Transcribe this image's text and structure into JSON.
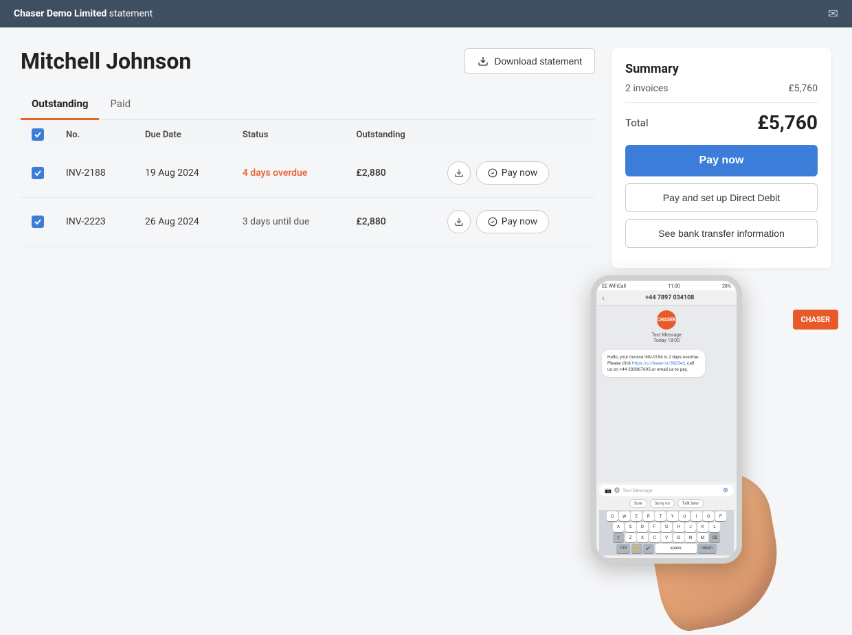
{
  "topbar": {
    "company": "Chaser Demo Limited",
    "suffix": " statement",
    "mail_icon": "✉"
  },
  "page": {
    "title": "Mitchell Johnson",
    "download_btn": "Download statement",
    "tabs": [
      {
        "id": "outstanding",
        "label": "Outstanding",
        "active": true
      },
      {
        "id": "paid",
        "label": "Paid",
        "active": false
      }
    ],
    "table": {
      "headers": [
        "",
        "No.",
        "Due Date",
        "Status",
        "Outstanding",
        ""
      ],
      "rows": [
        {
          "checked": true,
          "number": "INV-2188",
          "due_date": "19 Aug 2024",
          "status": "4 days overdue",
          "status_type": "overdue",
          "outstanding": "£2,880",
          "actions": [
            "download",
            "pay"
          ]
        },
        {
          "checked": true,
          "number": "INV-2223",
          "due_date": "26 Aug 2024",
          "status": "3 days until due",
          "status_type": "due",
          "outstanding": "£2,880",
          "actions": [
            "download",
            "pay"
          ]
        }
      ],
      "pay_label": "Pay now"
    }
  },
  "summary": {
    "title": "Summary",
    "invoice_count": "2 invoices",
    "invoice_total": "£5,760",
    "total_label": "Total",
    "total_amount": "£5,760",
    "btn_pay_now": "Pay now",
    "btn_direct_debit": "Pay and set up Direct Debit",
    "btn_bank_info": "See bank transfer information"
  },
  "phone": {
    "time": "11:00",
    "battery": "28%",
    "signal": "EE WiFiCall",
    "contact_number": "+44 7897 034108",
    "contact_label": "Text Message",
    "contact_date": "Today 18:00",
    "avatar_text": "CHASER",
    "message": "Hello, your invoice INV-0154 is 2 days overdue. Please click https://p.chaser.io/382342, call us on +44 203967695 or email us to pay.",
    "link_text": "https://p.chaser.io/382342",
    "input_placeholder": "Text Message",
    "quick_replies": [
      "Sure",
      "Sorry no",
      "Talk later"
    ],
    "keyboard_rows": [
      [
        "Q",
        "W",
        "E",
        "R",
        "T",
        "Y",
        "U",
        "I",
        "O",
        "P"
      ],
      [
        "A",
        "S",
        "D",
        "F",
        "G",
        "H",
        "J",
        "K",
        "L"
      ],
      [
        "⇧",
        "Z",
        "X",
        "C",
        "V",
        "B",
        "N",
        "M",
        "⌫"
      ],
      [
        "123",
        "🌐",
        "🎤",
        "space",
        "return"
      ]
    ],
    "chaser_logo": "CHASER"
  }
}
